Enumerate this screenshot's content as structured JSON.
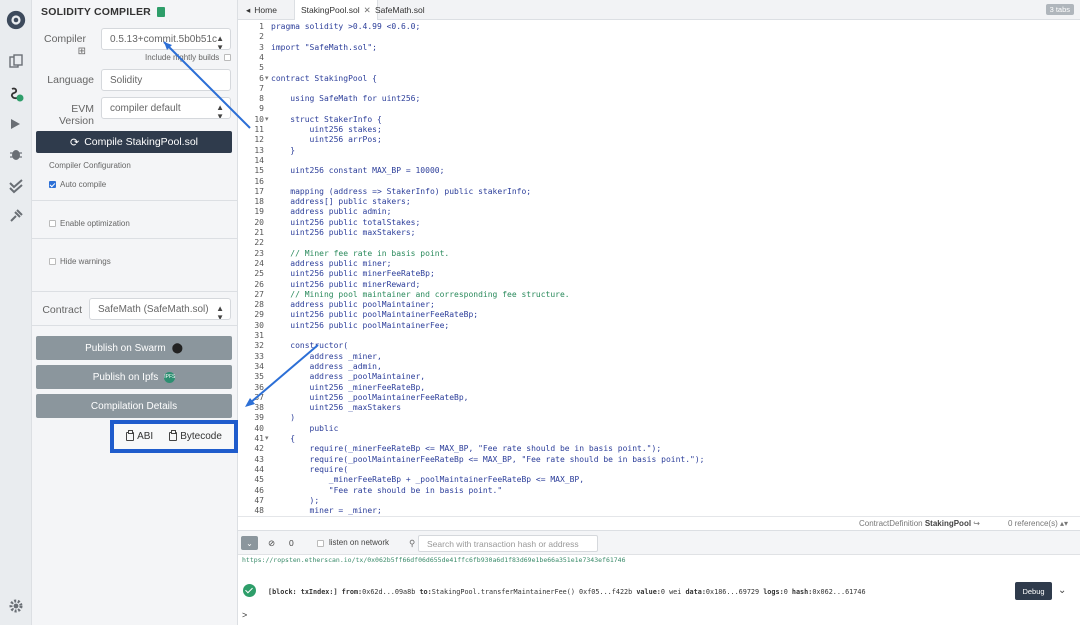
{
  "panel": {
    "title": "SOLIDITY COMPILER",
    "compiler_label": "Compiler",
    "compiler_value": "0.5.13+commit.5b0b51c",
    "nightly_label": "Include nightly builds",
    "language_label": "Language",
    "language_value": "Solidity",
    "evm_label": "EVM Version",
    "evm_value": "compiler default",
    "compile_button": "Compile StakingPool.sol",
    "config_title": "Compiler Configuration",
    "auto_compile": "Auto compile",
    "enable_optimization": "Enable optimization",
    "hide_warnings": "Hide warnings",
    "contract_label": "Contract",
    "contract_value": "SafeMath (SafeMath.sol)",
    "publish_swarm": "Publish on Swarm",
    "publish_ipfs": "Publish on Ipfs",
    "ipfs_badge": "IPFS",
    "compilation_details": "Compilation Details",
    "abi_label": "ABI",
    "bytecode_label": "Bytecode"
  },
  "tabs": {
    "home": "Home",
    "staking": "StakingPool.sol",
    "safemath": "SafeMath.sol",
    "count": "3 tabs"
  },
  "code_lines": [
    {
      "n": "1",
      "t": "pragma solidity >0.4.99 <0.6.0;"
    },
    {
      "n": "2",
      "t": ""
    },
    {
      "n": "3",
      "t": "import \"SafeMath.sol\";"
    },
    {
      "n": "4",
      "t": ""
    },
    {
      "n": "5",
      "t": ""
    },
    {
      "n": "6",
      "t": "contract StakingPool {"
    },
    {
      "n": "7",
      "t": ""
    },
    {
      "n": "8",
      "t": "    using SafeMath for uint256;"
    },
    {
      "n": "9",
      "t": ""
    },
    {
      "n": "10",
      "t": "    struct StakerInfo {"
    },
    {
      "n": "11",
      "t": "        uint256 stakes;"
    },
    {
      "n": "12",
      "t": "        uint256 arrPos;"
    },
    {
      "n": "13",
      "t": "    }"
    },
    {
      "n": "14",
      "t": ""
    },
    {
      "n": "15",
      "t": "    uint256 constant MAX_BP = 10000;"
    },
    {
      "n": "16",
      "t": ""
    },
    {
      "n": "17",
      "t": "    mapping (address => StakerInfo) public stakerInfo;"
    },
    {
      "n": "18",
      "t": "    address[] public stakers;"
    },
    {
      "n": "19",
      "t": "    address public admin;"
    },
    {
      "n": "20",
      "t": "    uint256 public totalStakes;"
    },
    {
      "n": "21",
      "t": "    uint256 public maxStakers;"
    },
    {
      "n": "22",
      "t": ""
    },
    {
      "n": "23",
      "t": "    // Miner fee rate in basis point."
    },
    {
      "n": "24",
      "t": "    address public miner;"
    },
    {
      "n": "25",
      "t": "    uint256 public minerFeeRateBp;"
    },
    {
      "n": "26",
      "t": "    uint256 public minerReward;"
    },
    {
      "n": "27",
      "t": "    // Mining pool maintainer and corresponding fee structure."
    },
    {
      "n": "28",
      "t": "    address public poolMaintainer;"
    },
    {
      "n": "29",
      "t": "    uint256 public poolMaintainerFeeRateBp;"
    },
    {
      "n": "30",
      "t": "    uint256 public poolMaintainerFee;"
    },
    {
      "n": "31",
      "t": ""
    },
    {
      "n": "32",
      "t": "    constructor("
    },
    {
      "n": "33",
      "t": "        address _miner,"
    },
    {
      "n": "34",
      "t": "        address _admin,"
    },
    {
      "n": "35",
      "t": "        address _poolMaintainer,"
    },
    {
      "n": "36",
      "t": "        uint256 _minerFeeRateBp,"
    },
    {
      "n": "37",
      "t": "        uint256 _poolMaintainerFeeRateBp,"
    },
    {
      "n": "38",
      "t": "        uint256 _maxStakers"
    },
    {
      "n": "39",
      "t": "    )"
    },
    {
      "n": "40",
      "t": "        public"
    },
    {
      "n": "41",
      "t": "    {"
    },
    {
      "n": "42",
      "t": "        require(_minerFeeRateBp <= MAX_BP, \"Fee rate should be in basis point.\");"
    },
    {
      "n": "43",
      "t": "        require(_poolMaintainerFeeRateBp <= MAX_BP, \"Fee rate should be in basis point.\");"
    },
    {
      "n": "44",
      "t": "        require("
    },
    {
      "n": "45",
      "t": "            _minerFeeRateBp + _poolMaintainerFeeRateBp <= MAX_BP,"
    },
    {
      "n": "46",
      "t": "            \"Fee rate should be in basis point.\""
    },
    {
      "n": "47",
      "t": "        );"
    },
    {
      "n": "48",
      "t": "        miner = _miner;"
    }
  ],
  "editor_status": {
    "definition_prefix": "ContractDefinition",
    "definition_name": "StakingPool",
    "references": "0 reference(s)"
  },
  "terminal": {
    "count": "0",
    "listen_label": "listen on network",
    "search_placeholder": "Search with transaction hash or address",
    "link": "https://ropsten.etherscan.io/tx/0x062b5ff66df06d655de41ffc6fb930a6d1f83d69e1be66a351e1e7343ef61746",
    "tx_block": "[block: txIndex:]",
    "tx_from_label": "from:",
    "tx_from": "0x62d...09a8b",
    "tx_to_label": "to:",
    "tx_to": "StakingPool.transferMaintainerFee() 0xf05...f422b",
    "tx_value_label": "value:",
    "tx_value": "0 wei",
    "tx_data_label": "data:",
    "tx_data": "0x186...69729",
    "tx_logs_label": "logs:",
    "tx_logs": "0",
    "tx_hash_label": "hash:",
    "tx_hash": "0x062...61746",
    "debug_button": "Debug",
    "prompt": ">"
  },
  "colors": {
    "dark_button": "#2f3b4c",
    "gray_button": "#8b969d",
    "highlight_box": "#1f5ccc",
    "success": "#2e9e6a"
  }
}
